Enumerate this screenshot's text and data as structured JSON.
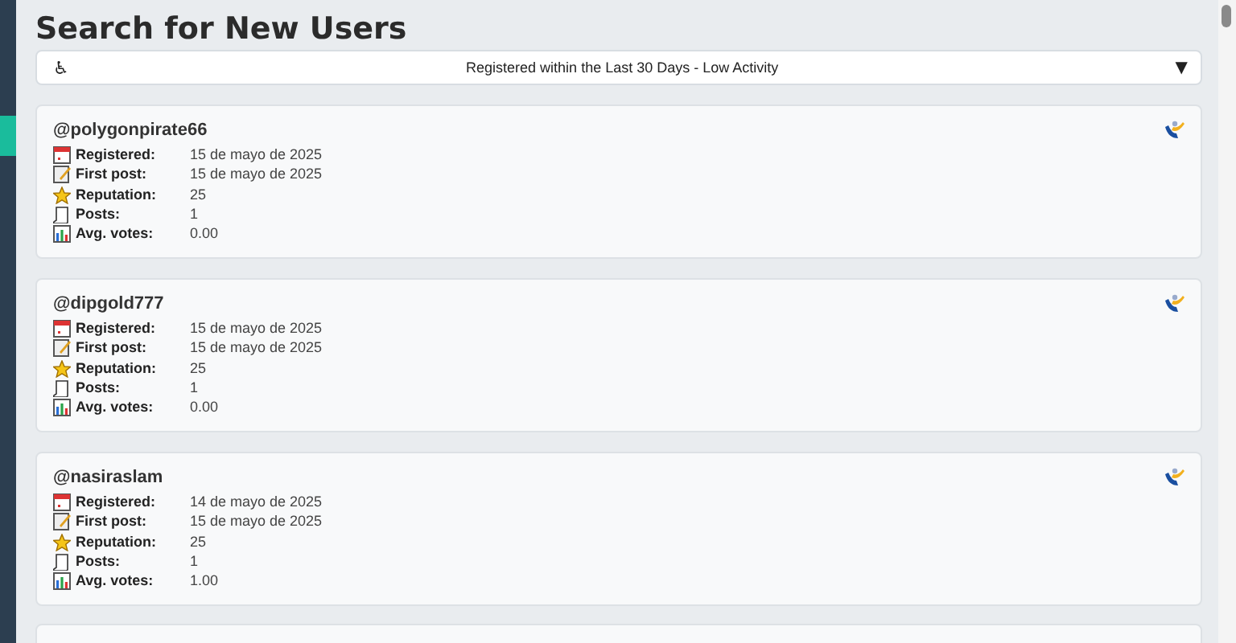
{
  "title": "Search for New Users",
  "filter": {
    "icon": "♿",
    "value": "Registered within the Last 30 Days - Low Activity",
    "arrow": "▼"
  },
  "users": [
    {
      "handle": "@polygonpirate66",
      "fields": [
        {
          "kind": "registered",
          "label": "Registered:",
          "value": "15 de mayo de 2025"
        },
        {
          "kind": "first_post",
          "label": "First post:",
          "value": "15 de mayo de 2025"
        },
        {
          "kind": "reputation",
          "label": "Reputation:",
          "value": "25"
        },
        {
          "kind": "posts",
          "label": "Posts:",
          "value": "1"
        },
        {
          "kind": "votes",
          "label": "Avg. votes:",
          "value": "0.00"
        }
      ]
    },
    {
      "handle": "@dipgold777",
      "fields": [
        {
          "kind": "registered",
          "label": "Registered:",
          "value": "15 de mayo de 2025"
        },
        {
          "kind": "first_post",
          "label": "First post:",
          "value": "15 de mayo de 2025"
        },
        {
          "kind": "reputation",
          "label": "Reputation:",
          "value": "25"
        },
        {
          "kind": "posts",
          "label": "Posts:",
          "value": "1"
        },
        {
          "kind": "votes",
          "label": "Avg. votes:",
          "value": "0.00"
        }
      ]
    },
    {
      "handle": "@nasiraslam",
      "fields": [
        {
          "kind": "registered",
          "label": "Registered:",
          "value": "14 de mayo de 2025"
        },
        {
          "kind": "first_post",
          "label": "First post:",
          "value": "15 de mayo de 2025"
        },
        {
          "kind": "reputation",
          "label": "Reputation:",
          "value": "25"
        },
        {
          "kind": "posts",
          "label": "Posts:",
          "value": "1"
        },
        {
          "kind": "votes",
          "label": "Avg. votes:",
          "value": "1.00"
        }
      ]
    }
  ]
}
